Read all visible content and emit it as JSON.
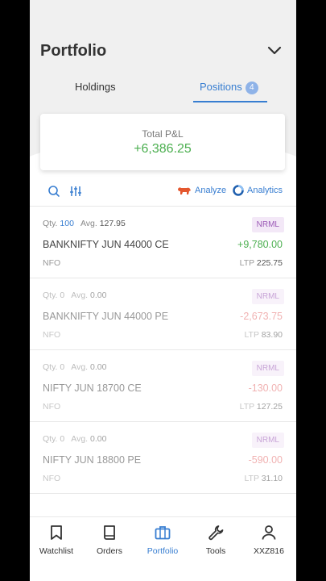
{
  "header": {
    "title": "Portfolio"
  },
  "tabs": [
    {
      "label": "Holdings",
      "active": false
    },
    {
      "label": "Positions",
      "badge": "4",
      "active": true
    }
  ],
  "pnl": {
    "label": "Total P&L",
    "value": "+6,386.25"
  },
  "toolbar": {
    "analyze_label": "Analyze",
    "analytics_label": "Analytics"
  },
  "positions": [
    {
      "qty_label": "Qty.",
      "qty": "100",
      "avg_label": "Avg.",
      "avg": "127.95",
      "product": "NRML",
      "symbol": "BANKNIFTY JUN 44000 CE",
      "pnl": "+9,780.00",
      "exchange": "NFO",
      "ltp_label": "LTP",
      "ltp": "225.75"
    },
    {
      "qty_label": "Qty.",
      "qty": "0",
      "avg_label": "Avg.",
      "avg": "0.00",
      "product": "NRML",
      "symbol": "BANKNIFTY JUN 44000 PE",
      "pnl": "-2,673.75",
      "exchange": "NFO",
      "ltp_label": "LTP",
      "ltp": "83.90"
    },
    {
      "qty_label": "Qty.",
      "qty": "0",
      "avg_label": "Avg.",
      "avg": "0.00",
      "product": "NRML",
      "symbol": "NIFTY JUN 18700 CE",
      "pnl": "-130.00",
      "exchange": "NFO",
      "ltp_label": "LTP",
      "ltp": "127.25"
    },
    {
      "qty_label": "Qty.",
      "qty": "0",
      "avg_label": "Avg.",
      "avg": "0.00",
      "product": "NRML",
      "symbol": "NIFTY JUN 18800 PE",
      "pnl": "-590.00",
      "exchange": "NFO",
      "ltp_label": "LTP",
      "ltp": "31.10"
    }
  ],
  "nav": [
    {
      "label": "Watchlist",
      "icon": "bookmark-icon"
    },
    {
      "label": "Orders",
      "icon": "book-icon"
    },
    {
      "label": "Portfolio",
      "icon": "briefcase-icon",
      "active": true
    },
    {
      "label": "Tools",
      "icon": "wrench-icon"
    },
    {
      "label": "XXZ816",
      "icon": "user-icon"
    }
  ],
  "colors": {
    "accent": "#387ed1",
    "profit": "#4caf50",
    "loss": "#e57373",
    "product_badge": "#9b59b6"
  }
}
